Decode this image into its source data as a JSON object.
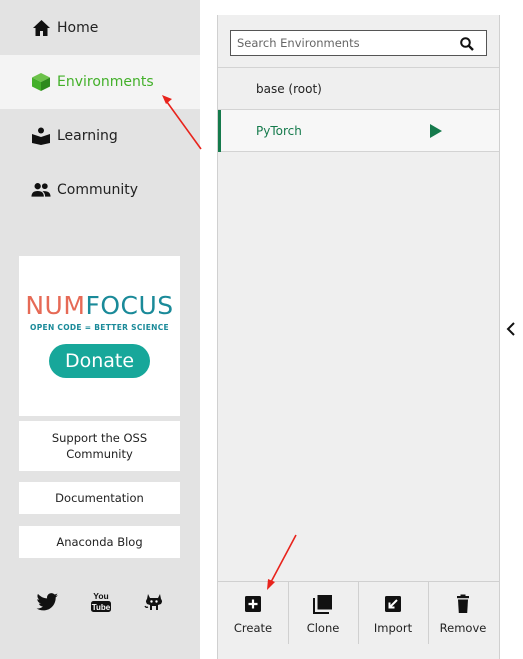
{
  "sidebar": {
    "nav": [
      {
        "label": "Home",
        "icon": "home-icon"
      },
      {
        "label": "Environments",
        "icon": "cube-icon"
      },
      {
        "label": "Learning",
        "icon": "book-icon"
      },
      {
        "label": "Community",
        "icon": "people-icon"
      }
    ],
    "active_color": "#43b02a",
    "numfocus": {
      "logo_num": "NUM",
      "logo_focus": "FOCUS",
      "tagline": "OPEN CODE = BETTER SCIENCE",
      "donate_label": "Donate"
    },
    "links": [
      "Support the OSS Community",
      "Documentation",
      "Anaconda Blog"
    ],
    "social_icons": [
      "twitter-icon",
      "youtube-icon",
      "github-icon"
    ]
  },
  "environments": {
    "search_placeholder": "Search Environments",
    "items": [
      {
        "name": "base (root)",
        "active": false
      },
      {
        "name": "PyTorch",
        "active": true
      }
    ],
    "active_color": "#157a4c",
    "actions": [
      {
        "label": "Create",
        "icon": "plus-box-icon"
      },
      {
        "label": "Clone",
        "icon": "clone-icon"
      },
      {
        "label": "Import",
        "icon": "import-icon"
      },
      {
        "label": "Remove",
        "icon": "trash-icon"
      }
    ]
  },
  "annotation_color": "#e8231c"
}
